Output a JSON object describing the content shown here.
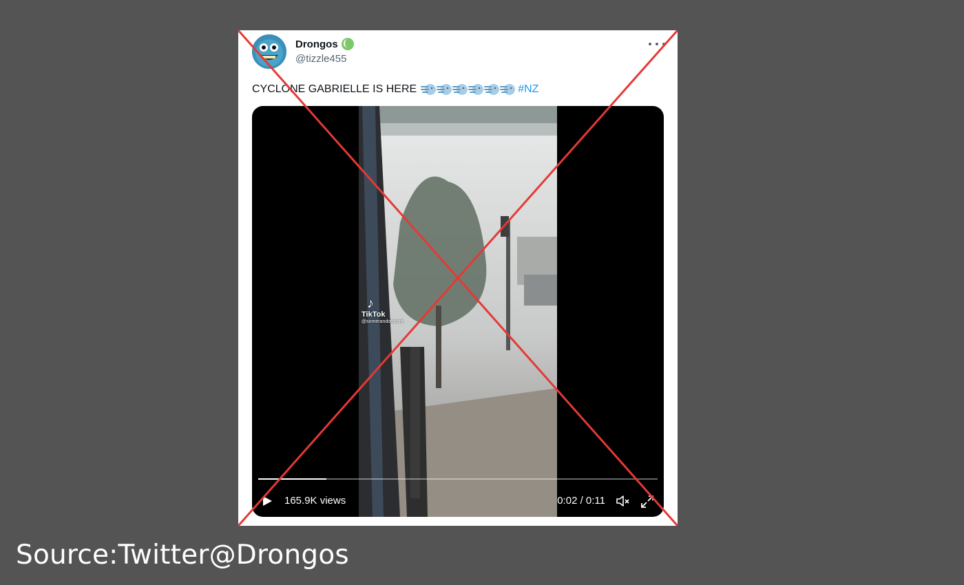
{
  "tweet": {
    "display_name": "Drongos",
    "handle": "@tizzle455",
    "text": "CYCLONE GABRIELLE IS HERE",
    "emoji_icons": [
      "wind-face-icon",
      "wind-face-icon",
      "wind-face-icon",
      "wind-face-icon",
      "wind-face-icon",
      "wind-face-icon"
    ],
    "hashtag": "#NZ",
    "badge_icon": "tennis-ball-icon",
    "more_icon": "ellipsis-icon"
  },
  "video": {
    "views": "165.9K views",
    "time": "0:02 / 0:11",
    "progress": 0.17,
    "watermark": {
      "brand": "TikTok",
      "user": "@somerandomcvnt"
    },
    "icons": {
      "play": "play-icon",
      "mute": "mute-icon",
      "fullscreen": "fullscreen-icon"
    }
  },
  "overlay": {
    "cross_color": "#e53935"
  },
  "footer": {
    "source": "Source:Twitter@Drongos"
  },
  "colors": {
    "background": "#545454",
    "link": "#1d9bf0",
    "card": "#ffffff"
  }
}
